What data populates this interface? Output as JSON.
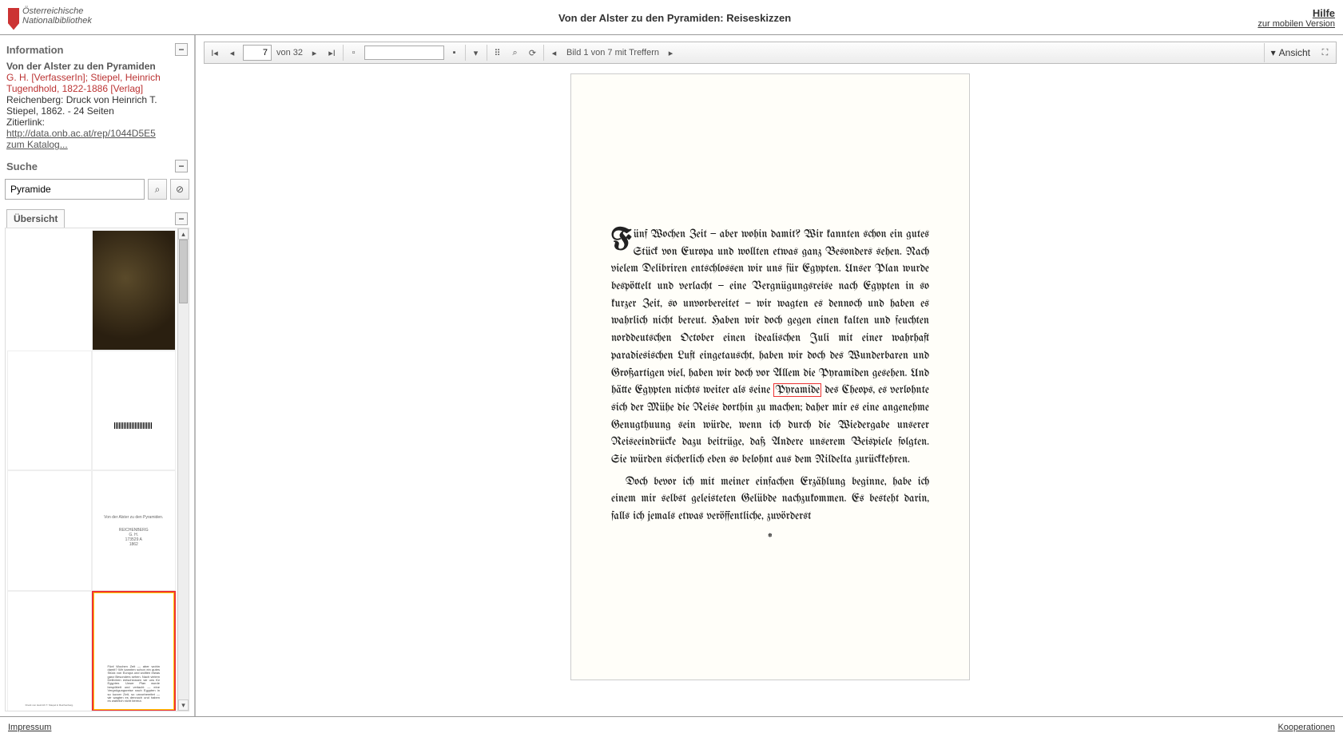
{
  "header": {
    "institution_line1": "Österreichische",
    "institution_line2": "Nationalbibliothek",
    "title": "Von der Alster zu den Pyramiden: Reiseskizzen",
    "help": "Hilfe",
    "mobile_link": "zur mobilen Version"
  },
  "sidebar": {
    "info_heading": "Information",
    "title": "Von der Alster zu den Pyramiden",
    "author": "G. H. [VerfasserIn]; Stiepel, Heinrich Tugendhold, 1822-1886 [Verlag]",
    "imprint": "Reichenberg: Druck von Heinrich T. Stiepel, 1862. - 24 Seiten",
    "zitierlink_label": "Zitierlink:",
    "zitierlink_url": "http://data.onb.ac.at/rep/1044D5E5",
    "catalog_link": "zum Katalog...",
    "search_heading": "Suche",
    "search_value": "Pyramide",
    "overview_tab": "Übersicht"
  },
  "toolbar": {
    "page_input": "7",
    "page_total_label": "von 32",
    "hit_text": "Bild 1 von 7 mit Treffern",
    "ansicht_label": "Ansicht"
  },
  "page_content": {
    "para1": "ünf Wochen Zeit — aber wohin damit? Wir kannten schon ein gutes Stück von Europa und wollten etwas ganz Besonders sehen. Nach vielem Delibriren entschlossen wir uns für Egypten. Unser Plan wurde bespöttelt und verlacht — eine Vergnügungsreise nach Egypten in so kurzer Zeit, so unvorbereitet — wir wagten es dennoch und haben es wahrlich nicht bereut. Haben wir doch gegen einen kalten und feuchten norddeutschen October einen idealischen Juli mit einer wahrhaft paradiesischen Luft eingetauscht, haben wir doch des Wunderbaren und Großartigen viel, haben wir doch vor Allem die Pyramiden gesehen. Und hätte Egypten nichts weiter als seine ",
    "hit_word": "Pyramide",
    "para1b": " des Cheops, es verlohnte sich der Mühe die Reise dorthin zu machen; daher mir es eine angenehme Genugthuung sein würde, wenn ich durch die Wiedergabe unserer Reiseeindrücke dazu beitrüge, daß Andere unserem Beispiele folgten. Sie würden sicherlich eben so belohnt aus dem Nildelta zurückkehren.",
    "para2": "Doch bevor ich mit meiner einfachen Erzählung beginne, habe ich einem mir selbst geleisteten Gelübde nachzukommen. Es besteht darin, falls ich jemals etwas veröffentliche, zuvörderst",
    "dropcap": "F"
  },
  "footer": {
    "impressum": "Impressum",
    "kooperationen": "Kooperationen"
  }
}
